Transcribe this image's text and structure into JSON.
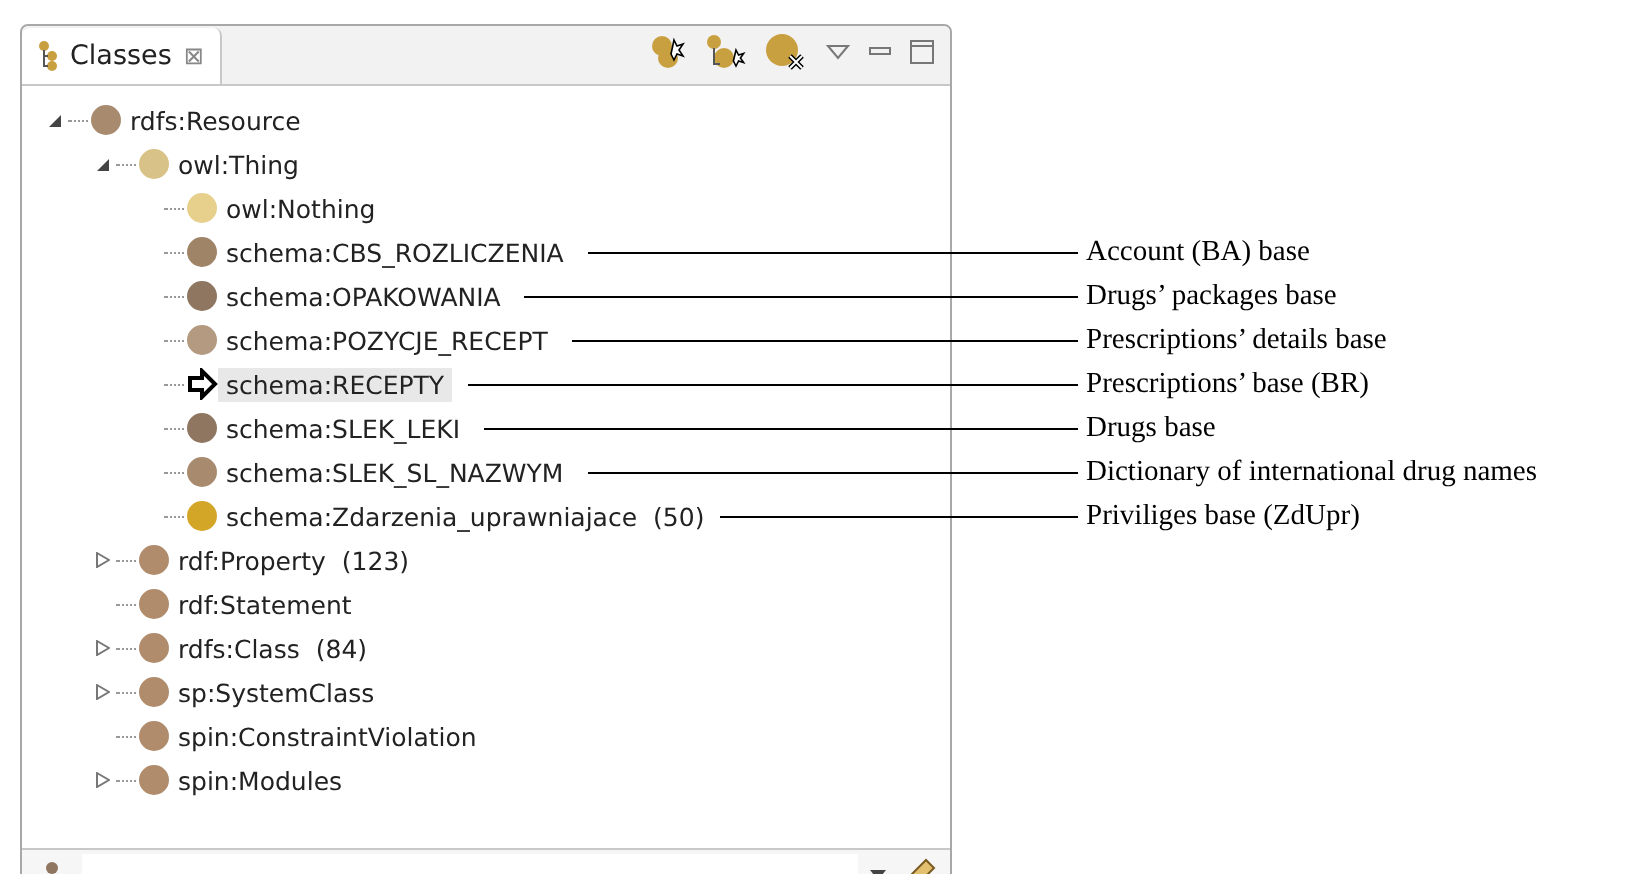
{
  "view": {
    "tab": {
      "label": "Classes",
      "close": "⊠",
      "selected": true
    }
  },
  "tree": [
    {
      "label": "rdfs:Resource",
      "color": "#a88a6e",
      "kind": "class",
      "expanded": true,
      "children": [
        {
          "label": "owl:Thing",
          "color": "#d8c287",
          "kind": "class",
          "expanded": true,
          "children": [
            {
              "label": "owl:Nothing",
              "color": "#e6d08c",
              "kind": "class"
            },
            {
              "label": "schema:CBS_ROZLICZENIA",
              "color": "#a08468",
              "kind": "class",
              "annotation": "Account (BA) base"
            },
            {
              "label": "schema:OPAKOWANIA",
              "color": "#8e7660",
              "kind": "class",
              "annotation": "Drugs’ packages base"
            },
            {
              "label": "schema:POZYCJE_RECEPT",
              "color": "#b49a80",
              "kind": "class",
              "annotation": "Prescriptions’ details base"
            },
            {
              "label": "schema:RECEPTY",
              "kind": "arrow",
              "selected": true,
              "annotation": "Prescriptions’ base (BR)"
            },
            {
              "label": "schema:SLEK_LEKI",
              "color": "#8e7660",
              "kind": "class",
              "annotation": "Drugs base"
            },
            {
              "label": "schema:SLEK_SL_NAZWYM",
              "color": "#a88a6e",
              "kind": "class",
              "annotation": "Dictionary of international drug names"
            },
            {
              "label": "schema:Zdarzenia_uprawniajace",
              "count": "(50)",
              "color": "#d4a628",
              "kind": "class",
              "annotation": "Priviliges base (ZdUpr)"
            }
          ]
        },
        {
          "label": "rdf:Property",
          "count": "(123)",
          "color": "#b08c6c",
          "kind": "class",
          "expanded": false
        },
        {
          "label": "rdf:Statement",
          "color": "#b08c6c",
          "kind": "class"
        },
        {
          "label": "rdfs:Class",
          "count": "(84)",
          "color": "#b08c6c",
          "kind": "class",
          "expanded": false
        },
        {
          "label": "sp:SystemClass",
          "color": "#b08c6c",
          "kind": "class",
          "expanded": false
        },
        {
          "label": "spin:ConstraintViolation",
          "color": "#b08c6c",
          "kind": "class"
        },
        {
          "label": "spin:Modules",
          "color": "#b08c6c",
          "kind": "class",
          "expanded": false
        }
      ]
    }
  ]
}
